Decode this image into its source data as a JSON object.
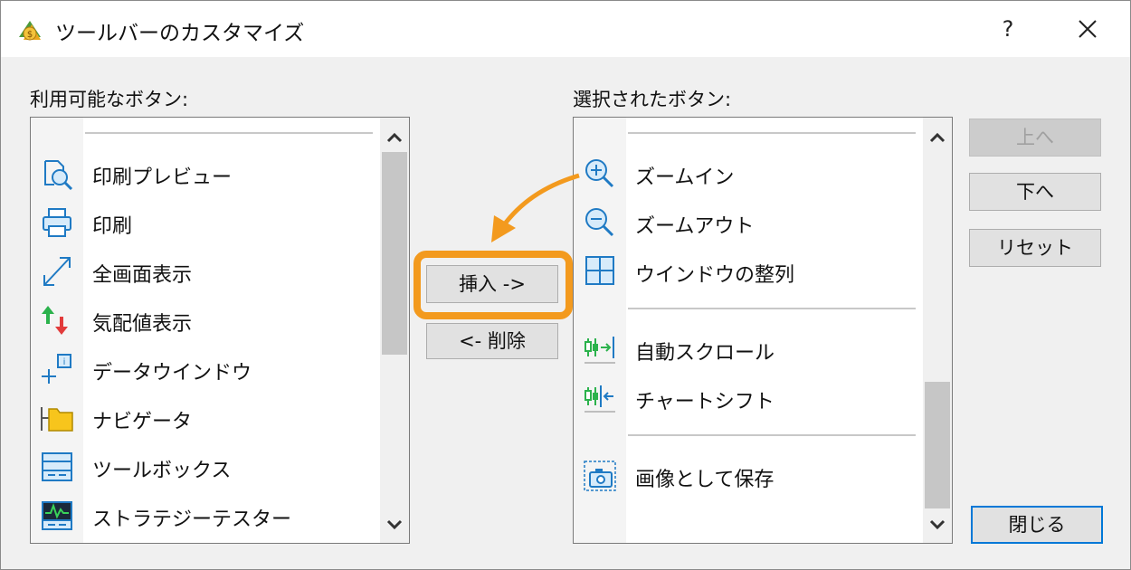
{
  "window": {
    "title": "ツールバーのカスタマイズ",
    "help_label": "?"
  },
  "available": {
    "label": "利用可能なボタン:",
    "items": [
      {
        "label": "印刷プレビュー",
        "icon": "print-preview-icon"
      },
      {
        "label": "印刷",
        "icon": "printer-icon"
      },
      {
        "label": "全画面表示",
        "icon": "fullscreen-arrow-icon"
      },
      {
        "label": "気配値表示",
        "icon": "market-watch-arrows-icon"
      },
      {
        "label": "データウインドウ",
        "icon": "data-window-icon"
      },
      {
        "label": "ナビゲータ",
        "icon": "navigator-folder-icon"
      },
      {
        "label": "ツールボックス",
        "icon": "toolbox-icon"
      },
      {
        "label": "ストラテジーテスター",
        "icon": "strategy-tester-icon"
      }
    ]
  },
  "selected": {
    "label": "選択されたボタン:",
    "items": [
      {
        "label": "ズームイン",
        "icon": "zoom-in-icon"
      },
      {
        "label": "ズームアウト",
        "icon": "zoom-out-icon"
      },
      {
        "label": "ウインドウの整列",
        "icon": "tile-windows-icon"
      },
      {
        "label": "自動スクロール",
        "icon": "auto-scroll-icon"
      },
      {
        "label": "チャートシフト",
        "icon": "chart-shift-icon"
      },
      {
        "label": "画像として保存",
        "icon": "camera-icon"
      }
    ]
  },
  "buttons": {
    "insert": "挿入 ->",
    "remove": "<- 削除",
    "up": "上へ",
    "down": "下へ",
    "reset": "リセット",
    "close": "閉じる"
  },
  "colors": {
    "highlight": "#f39a1e",
    "icon_blue": "#1f7ac4",
    "default_button_border": "#0078d7"
  }
}
